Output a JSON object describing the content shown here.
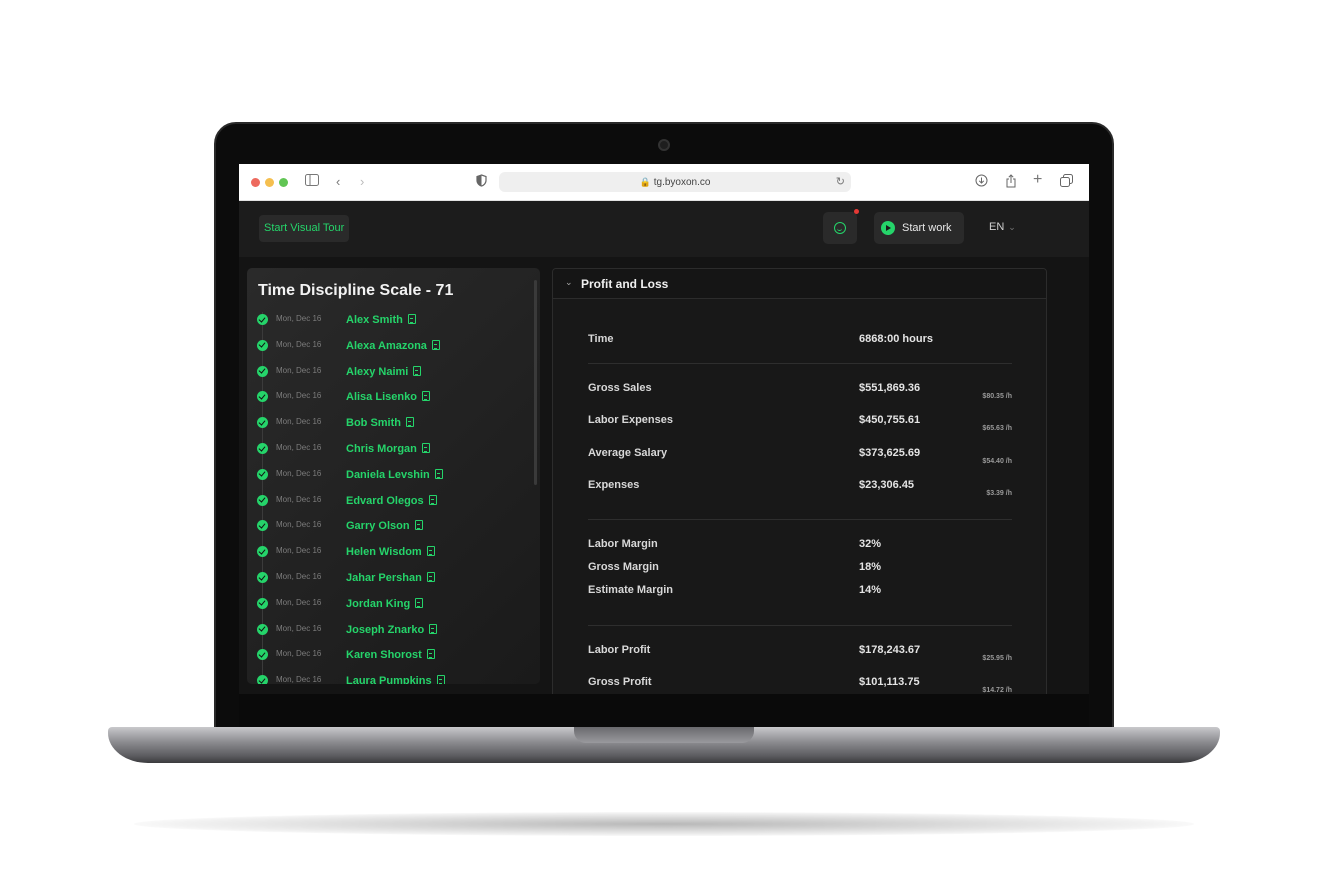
{
  "browser": {
    "url": "tg.byoxon.co",
    "traffic_colors": [
      "#ed6a5e",
      "#f5bf4f",
      "#61c554"
    ]
  },
  "header": {
    "tour_label": "Start Visual Tour",
    "start_work_label": "Start work",
    "language": "EN"
  },
  "colors": {
    "accent": "#25d46a",
    "panel": "#1c1c1c",
    "notification": "#e53935"
  },
  "scale": {
    "title": "Time Discipline Scale - 71",
    "entries": [
      {
        "date": "Mon, Dec 16",
        "name": "Alex Smith"
      },
      {
        "date": "Mon, Dec 16",
        "name": "Alexa Amazona"
      },
      {
        "date": "Mon, Dec 16",
        "name": "Alexy Naimi"
      },
      {
        "date": "Mon, Dec 16",
        "name": "Alisa Lisenko"
      },
      {
        "date": "Mon, Dec 16",
        "name": "Bob Smith"
      },
      {
        "date": "Mon, Dec 16",
        "name": "Chris Morgan"
      },
      {
        "date": "Mon, Dec 16",
        "name": "Daniela Levshin"
      },
      {
        "date": "Mon, Dec 16",
        "name": "Edvard Olegos"
      },
      {
        "date": "Mon, Dec 16",
        "name": "Garry Olson"
      },
      {
        "date": "Mon, Dec 16",
        "name": "Helen Wisdom"
      },
      {
        "date": "Mon, Dec 16",
        "name": "Jahar Pershan"
      },
      {
        "date": "Mon, Dec 16",
        "name": "Jordan King"
      },
      {
        "date": "Mon, Dec 16",
        "name": "Joseph Znarko"
      },
      {
        "date": "Mon, Dec 16",
        "name": "Karen Shorost"
      },
      {
        "date": "Mon, Dec 16",
        "name": "Laura Pumpkins"
      }
    ]
  },
  "pnl": {
    "title": "Profit and Loss",
    "time": {
      "label": "Time",
      "value": "6868:00 hours"
    },
    "sales": [
      {
        "label": "Gross Sales",
        "value": "$551,869.36",
        "rate": "$80.35 /h"
      },
      {
        "label": "Labor Expenses",
        "value": "$450,755.61",
        "rate": "$65.63 /h"
      },
      {
        "label": "Average Salary",
        "value": "$373,625.69",
        "rate": "$54.40 /h"
      },
      {
        "label": "Expenses",
        "value": "$23,306.45",
        "rate": "$3.39 /h"
      }
    ],
    "margins": [
      {
        "label": "Labor Margin",
        "value": "32%"
      },
      {
        "label": "Gross Margin",
        "value": "18%"
      },
      {
        "label": "Estimate Margin",
        "value": "14%"
      }
    ],
    "profits": [
      {
        "label": "Labor Profit",
        "value": "$178,243.67",
        "rate": "$25.95 /h"
      },
      {
        "label": "Gross Profit",
        "value": "$101,113.75",
        "rate": "$14.72 /h"
      }
    ]
  }
}
